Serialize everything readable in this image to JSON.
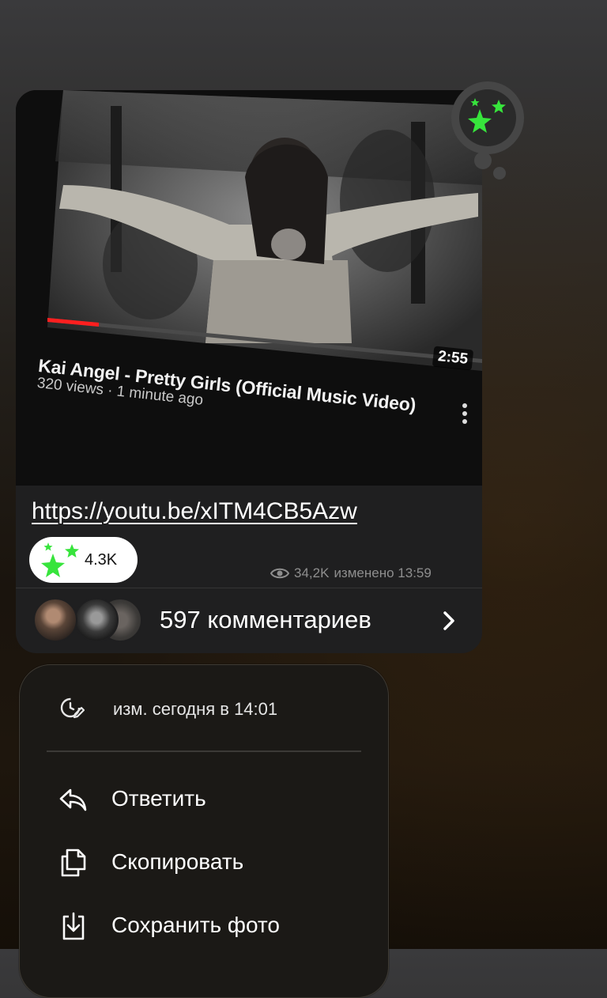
{
  "post": {
    "video_title": "Kai Angel - Pretty Girls (Official Music Video)",
    "video_meta": "320 views · 1 minute ago",
    "duration": "2:55",
    "link": "https://youtu.be/xITM4CB5Azw",
    "reaction_count": "4.3K",
    "views": "34,2K",
    "edited_label": "изменено 13:59",
    "comments_label": "597 комментариев"
  },
  "menu": {
    "edited_info": "изм. сегодня в 14:01",
    "items": [
      {
        "label": "Ответить",
        "icon": "reply-icon"
      },
      {
        "label": "Скопировать",
        "icon": "copy-icon"
      },
      {
        "label": "Сохранить фото",
        "icon": "download-icon"
      }
    ]
  },
  "colors": {
    "reaction_star": "#37e43c",
    "card_bg": "#1f1f20",
    "menu_bg": "#1b1916"
  }
}
